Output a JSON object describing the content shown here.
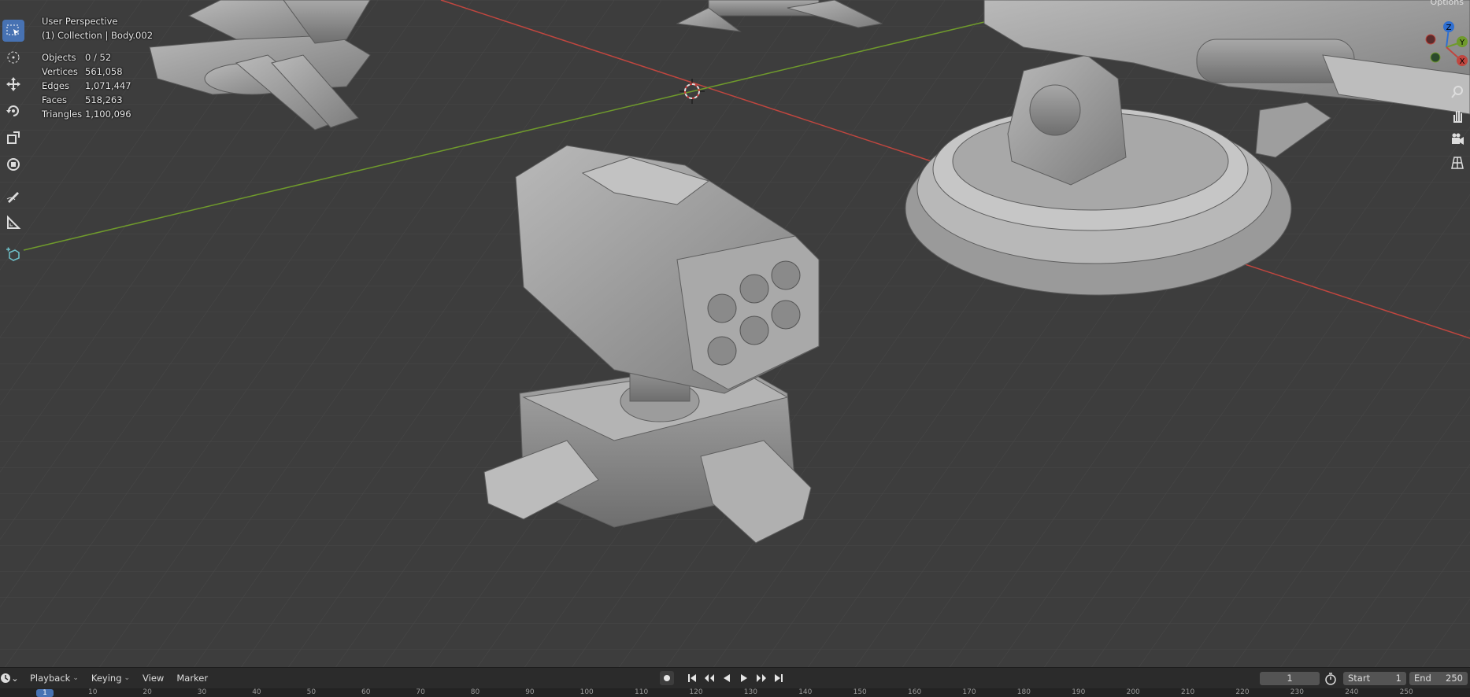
{
  "viewport": {
    "view_name": "User Perspective",
    "collection": "(1) Collection | Body.002",
    "stats": [
      {
        "label": "Objects",
        "value": "0 / 52"
      },
      {
        "label": "Vertices",
        "value": "561,058"
      },
      {
        "label": "Edges",
        "value": "1,071,447"
      },
      {
        "label": "Faces",
        "value": "518,263"
      },
      {
        "label": "Triangles",
        "value": "1,100,096"
      }
    ],
    "options_label": "Options",
    "gizmo": {
      "x": "X",
      "y": "Y",
      "z": "Z"
    },
    "colors": {
      "x_axis": "#c0463f",
      "y_axis": "#6f9a2c",
      "z_axis": "#2f6fd1",
      "active_tool": "#4772b3"
    }
  },
  "toolbar": {
    "tools": [
      {
        "name": "select-box-icon",
        "active": true
      },
      {
        "name": "cursor-icon",
        "active": false
      },
      {
        "name": "move-icon",
        "active": false
      },
      {
        "name": "rotate-icon",
        "active": false
      },
      {
        "name": "scale-icon",
        "active": false
      },
      {
        "name": "transform-icon",
        "active": false
      },
      {
        "name": "annotate-icon",
        "active": false
      },
      {
        "name": "measure-icon",
        "active": false
      },
      {
        "name": "add-cube-icon",
        "active": false
      }
    ]
  },
  "timeline": {
    "menu": {
      "playback": "Playback",
      "keying": "Keying",
      "view": "View",
      "marker": "Marker"
    },
    "current_frame": "1",
    "start_label": "Start",
    "start_value": "1",
    "end_label": "End",
    "end_value": "250",
    "ruler_current": "1",
    "ruler_ticks": [
      "10",
      "20",
      "30",
      "40",
      "50",
      "60",
      "70",
      "80",
      "90",
      "100",
      "110",
      "120",
      "130",
      "140",
      "150",
      "160",
      "170",
      "180",
      "190",
      "200",
      "210",
      "220",
      "230",
      "240",
      "250"
    ]
  }
}
